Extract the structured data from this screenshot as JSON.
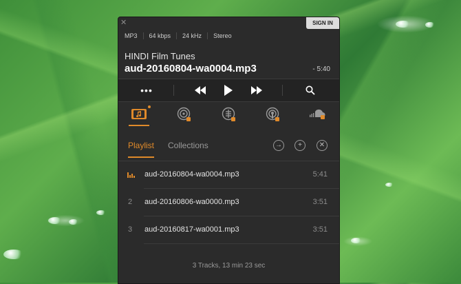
{
  "window": {
    "close_glyph": "✕",
    "sign_in_label": "SIGN IN"
  },
  "now_playing": {
    "meta": [
      "MP3",
      "64 kbps",
      "24 kHz",
      "Stereo"
    ],
    "album": "HINDI Film Tunes",
    "track": "aud-20160804-wa0004.mp3",
    "remaining": "- 5:40"
  },
  "controls": {
    "more_label": "•••"
  },
  "sources": {
    "items": [
      {
        "icon": "music-folder-icon",
        "active": true,
        "locked": false
      },
      {
        "icon": "radio-disc-icon",
        "active": false,
        "locked": true
      },
      {
        "icon": "audiobook-icon",
        "active": false,
        "locked": true
      },
      {
        "icon": "podcast-icon",
        "active": false,
        "locked": true
      },
      {
        "icon": "soundcloud-icon",
        "active": false,
        "locked": true
      }
    ]
  },
  "tabs": {
    "playlist": "Playlist",
    "collections": "Collections"
  },
  "playlist": {
    "tracks": [
      {
        "number": "",
        "name": "aud-20160804-wa0004.mp3",
        "duration": "5:41",
        "playing": true
      },
      {
        "number": "2",
        "name": "aud-20160806-wa0000.mp3",
        "duration": "3:51",
        "playing": false
      },
      {
        "number": "3",
        "name": "aud-20160817-wa0001.mp3",
        "duration": "3:51",
        "playing": false
      }
    ],
    "summary": "3 Tracks, 13 min 23 sec"
  },
  "colors": {
    "accent": "#e08a2a",
    "panel": "#2b2b2b"
  }
}
